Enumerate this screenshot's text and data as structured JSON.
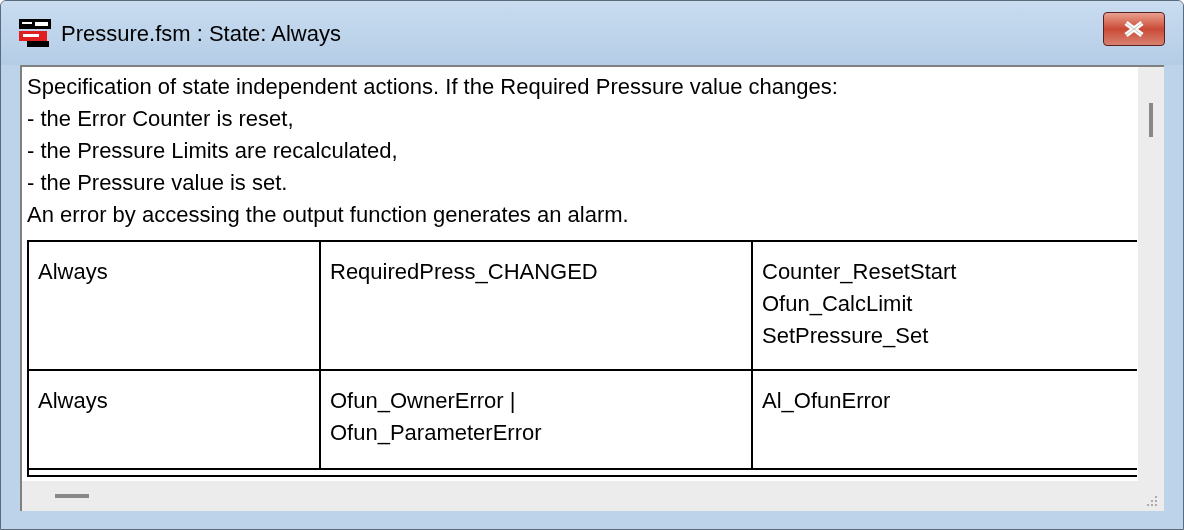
{
  "window": {
    "title": "Pressure.fsm : State: Always"
  },
  "description": [
    "Specification of state independent actions. If the Required Pressure value changes:",
    "- the Error Counter is reset,",
    "- the Pressure Limits are recalculated,",
    "- the Pressure value is set.",
    "An error by accessing the output function generates an alarm."
  ],
  "table": {
    "rows": [
      {
        "cells": [
          [
            "Always"
          ],
          [
            "RequiredPress_CHANGED"
          ],
          [
            "Counter_ResetStart",
            "Ofun_CalcLimit",
            "SetPressure_Set"
          ]
        ]
      },
      {
        "cells": [
          [
            "Always"
          ],
          [
            "Ofun_OwnerError |",
            "Ofun_ParameterError"
          ],
          [
            "Al_OfunError"
          ]
        ]
      }
    ]
  }
}
